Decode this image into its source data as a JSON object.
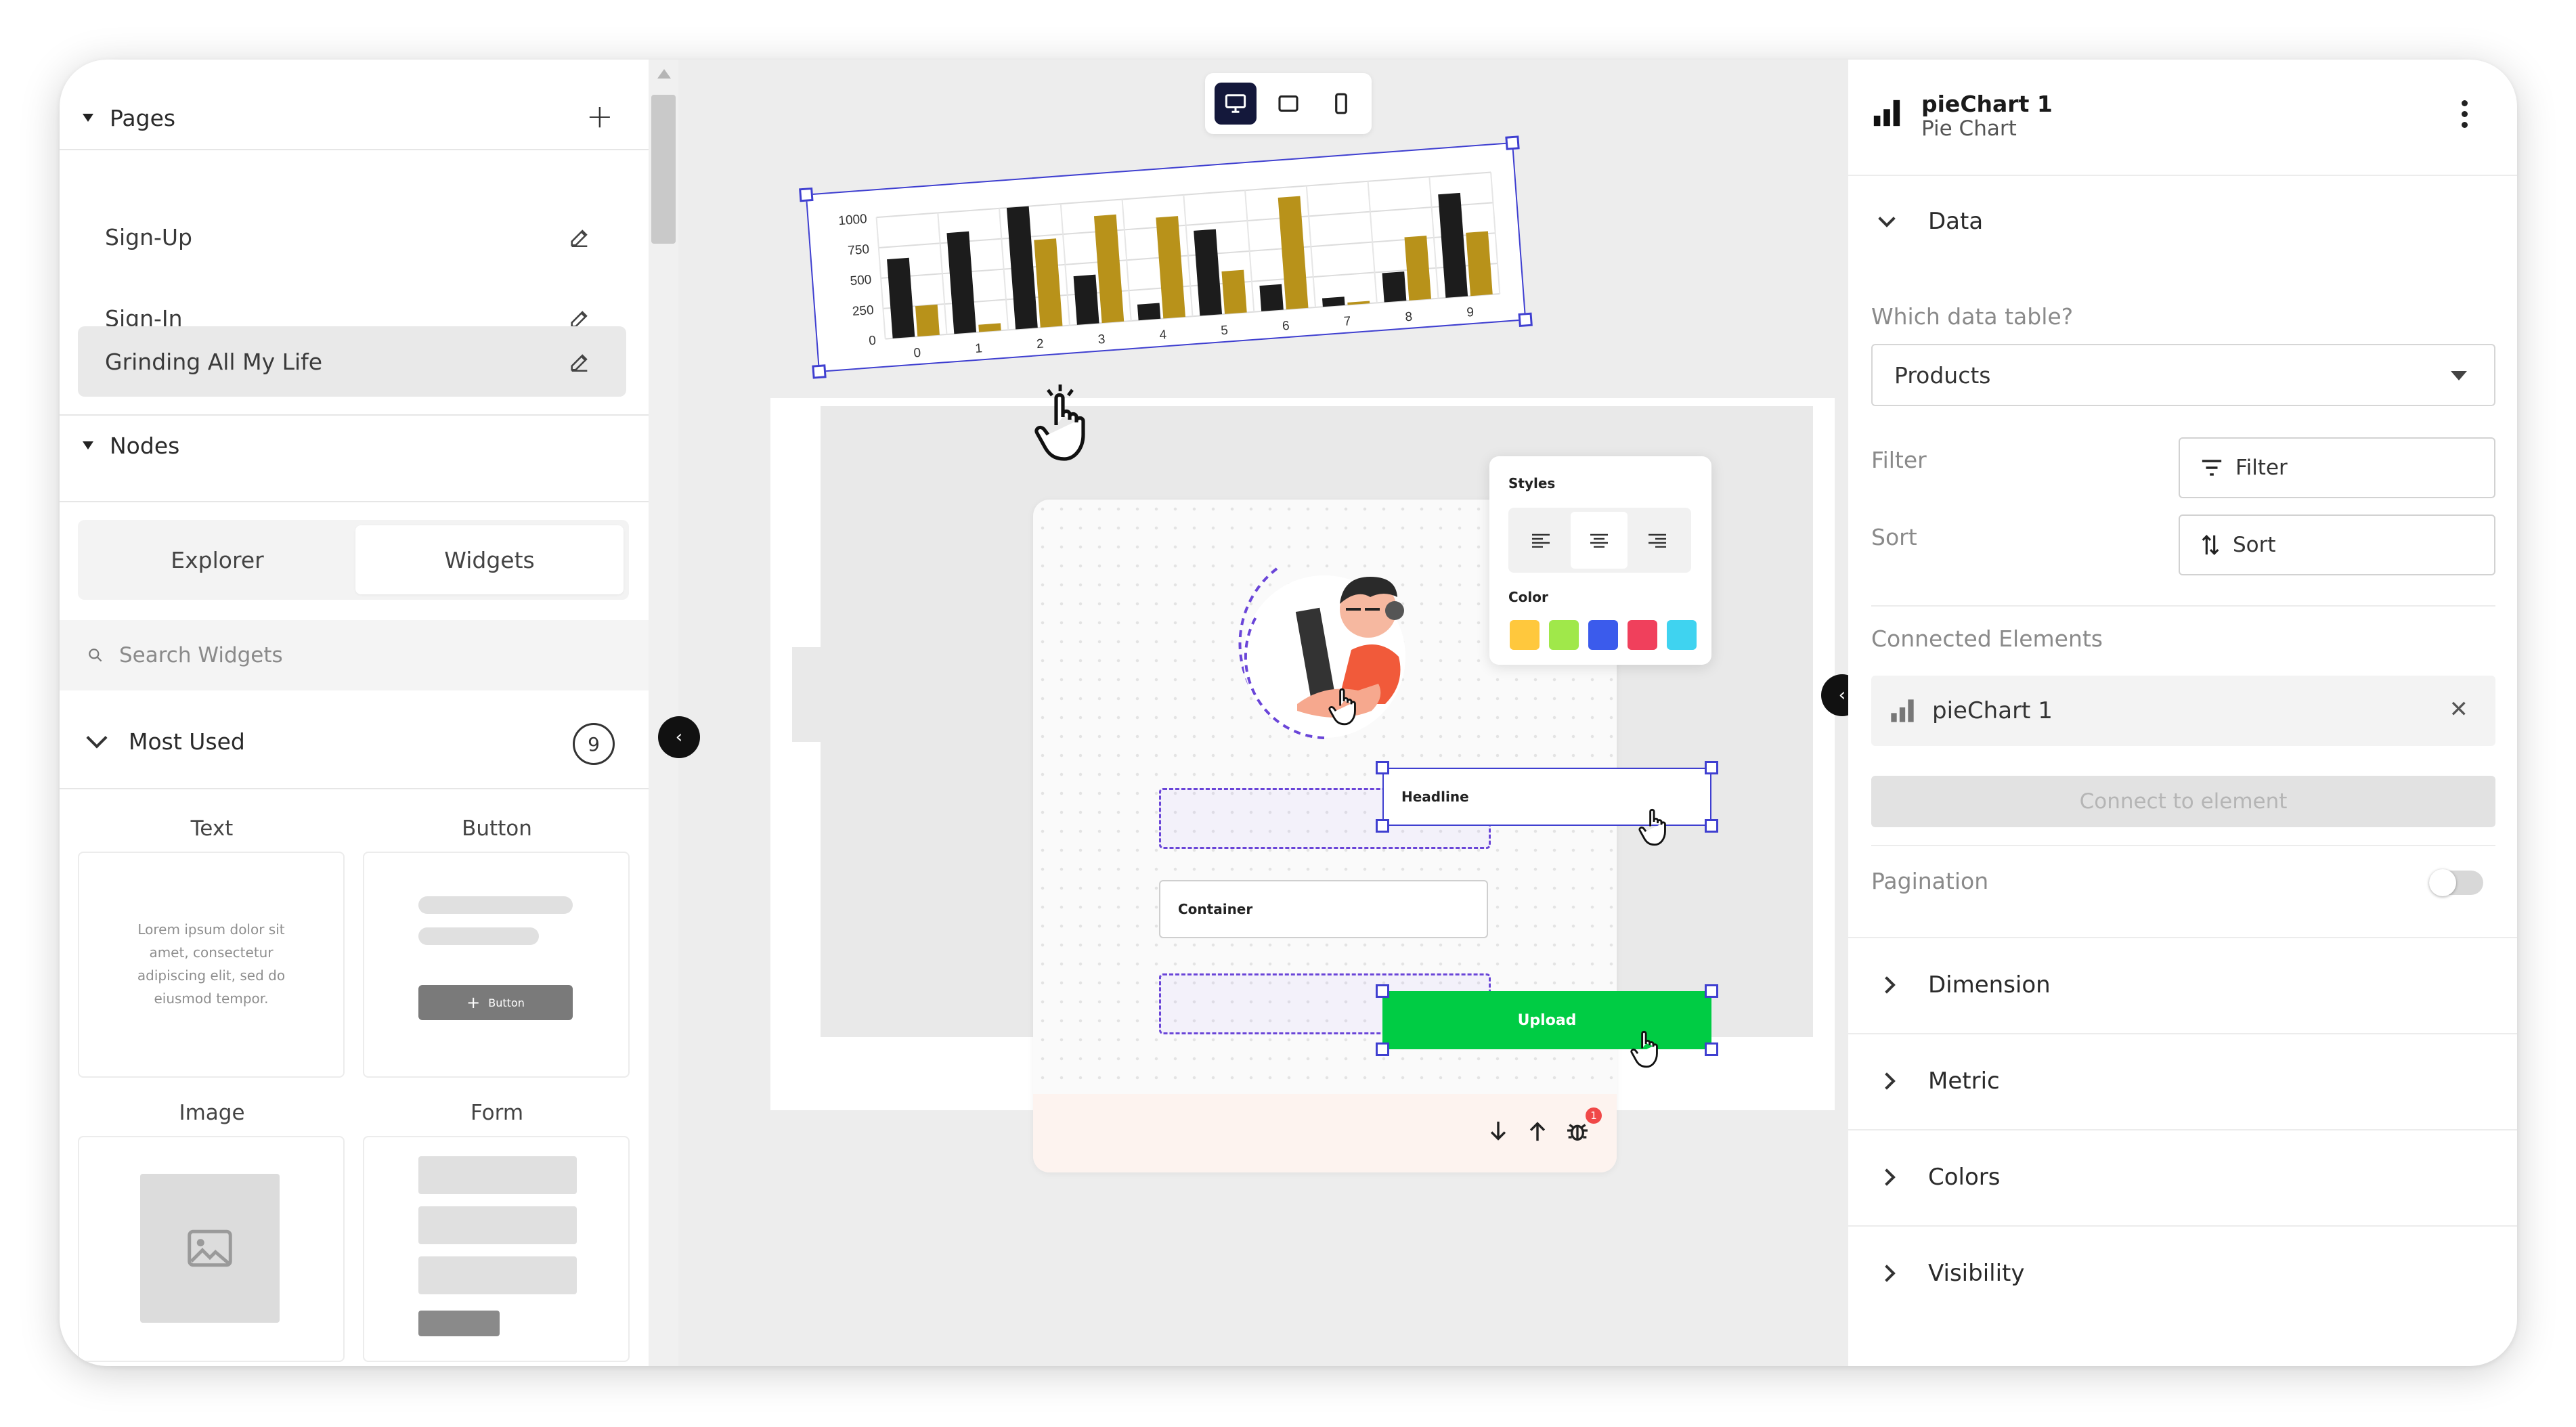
{
  "pages": {
    "title": "Pages",
    "items": [
      {
        "label": "Sign-Up"
      },
      {
        "label": "Sign-In"
      },
      {
        "label": "Grinding All My Life"
      }
    ]
  },
  "nodes": {
    "title": "Nodes"
  },
  "tabs": {
    "explorer": "Explorer",
    "widgets": "Widgets"
  },
  "search": {
    "placeholder": "Search Widgets"
  },
  "most_used": {
    "title": "Most Used",
    "count": "9"
  },
  "widgets": {
    "text": {
      "label": "Text",
      "preview": "Lorem ipsum dolor sit amet, consectetur adipiscing elit, sed do eiusmod tempor."
    },
    "button": {
      "label": "Button",
      "preview_button": "Button"
    },
    "image": {
      "label": "Image"
    },
    "form": {
      "label": "Form"
    }
  },
  "canvas": {
    "headline": "Headline",
    "container": "Container",
    "upload": "Upload",
    "styles_title": "Styles",
    "color_title": "Color",
    "swatches": [
      "#ffc83d",
      "#a0e84a",
      "#3b5bec",
      "#f0405c",
      "#3fd3f0"
    ],
    "notification_count": "1"
  },
  "chart_data": {
    "type": "bar",
    "categories": [
      "0",
      "1",
      "2",
      "3",
      "4",
      "5",
      "6",
      "7",
      "8",
      "9"
    ],
    "y_ticks": [
      "0",
      "250",
      "500",
      "750",
      "1000"
    ],
    "ylim": [
      0,
      1000
    ],
    "series": [
      {
        "values": [
          650,
          830,
          1000,
          400,
          130,
          700,
          210,
          70,
          240,
          850
        ],
        "color": "#1c1c1c"
      },
      {
        "values": [
          250,
          60,
          720,
          880,
          830,
          350,
          920,
          20,
          520,
          520
        ],
        "color": "#b8921a"
      }
    ]
  },
  "right_panel": {
    "title": "pieChart 1",
    "subtitle": "Pie Chart",
    "data_section": "Data",
    "which_table_label": "Which data table?",
    "table_value": "Products",
    "filter_label": "Filter",
    "filter_button": "Filter",
    "sort_label": "Sort",
    "sort_button": "Sort",
    "connected_label": "Connected Elements",
    "connected_item": "pieChart 1",
    "connect_button": "Connect to element",
    "pagination_label": "Pagination",
    "pagination_on": false,
    "sections": [
      "Dimension",
      "Metric",
      "Colors",
      "Visibility"
    ]
  }
}
